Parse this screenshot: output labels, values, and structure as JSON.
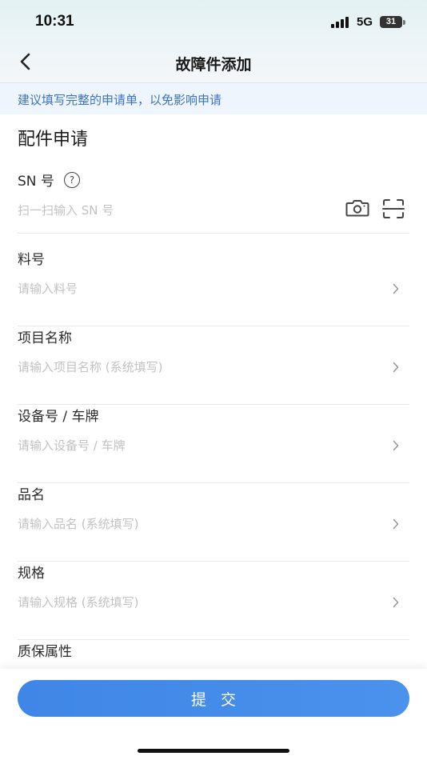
{
  "status_bar": {
    "time": "10:31",
    "network": "5G",
    "battery": "31"
  },
  "header": {
    "title": "故障件添加"
  },
  "tip": {
    "text": "建议填写完整的申请单，以免影响申请"
  },
  "form": {
    "section_title": "配件申请",
    "fields": [
      {
        "label": "SN 号",
        "placeholder": "扫一扫输入 SN 号",
        "value": ""
      },
      {
        "label": "料号",
        "placeholder": "请输入料号",
        "value": ""
      },
      {
        "label": "项目名称",
        "placeholder": "请输入项目名称 (系统填写)",
        "value": ""
      },
      {
        "label": "设备号 / 车牌",
        "placeholder": "请输入设备号 / 车牌",
        "value": ""
      },
      {
        "label": "品名",
        "placeholder": "请输入品名 (系统填写)",
        "value": ""
      },
      {
        "label": "规格",
        "placeholder": "请输入规格 (系统填写)",
        "value": ""
      },
      {
        "label": "质保属性"
      }
    ]
  },
  "footer": {
    "submit_label": "提交"
  },
  "colors": {
    "accent": "#4a90e8",
    "tip_text": "#3b73c6",
    "tip_bg": "#eef5fd",
    "placeholder": "#c2c2c2"
  },
  "icons": [
    "back-chevron-icon",
    "help-icon",
    "camera-icon",
    "scan-icon",
    "chevron-right-icon"
  ]
}
